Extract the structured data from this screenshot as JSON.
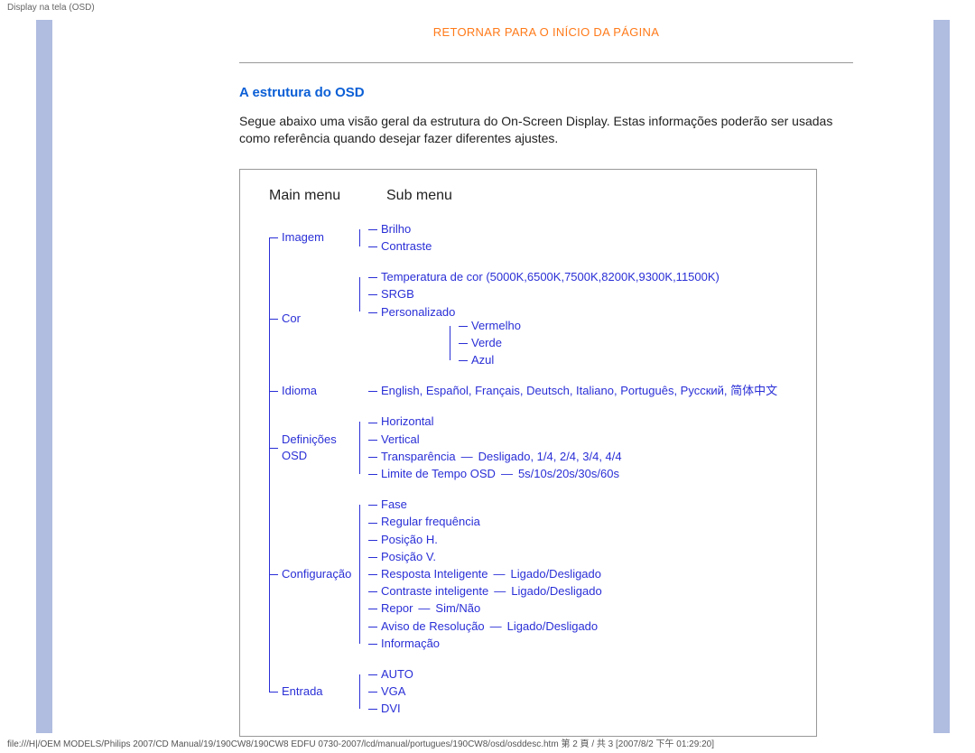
{
  "header": {
    "title": "Display na tela (OSD)"
  },
  "top_link": "Retornar para o início da página",
  "section": {
    "title": "A estrutura do OSD",
    "intro": "Segue abaixo uma visão geral da estrutura do On-Screen Display. Estas informações poderão ser usadas como referência quando desejar fazer diferentes ajustes."
  },
  "columns": {
    "main": "Main menu",
    "sub": "Sub menu"
  },
  "tree": [
    {
      "label": "Imagem",
      "subs": [
        {
          "label": "Brilho"
        },
        {
          "label": "Contraste"
        }
      ]
    },
    {
      "label": "Cor",
      "subs": [
        {
          "label": "Temperatura de cor (5000K,6500K,7500K,8200K,9300K,11500K)"
        },
        {
          "label": "SRGB"
        },
        {
          "label": "Personalizado",
          "children": [
            "Vermelho",
            "Verde",
            "Azul"
          ]
        }
      ]
    },
    {
      "label": "Idioma",
      "subs": [
        {
          "label": "English, Español, Français, Deutsch, Italiano, Português, Русский, 简体中文"
        }
      ]
    },
    {
      "label": "Definições OSD",
      "subs": [
        {
          "label": "Horizontal"
        },
        {
          "label": "Vertical"
        },
        {
          "label": "Transparência",
          "options": "Desligado, 1/4, 2/4, 3/4, 4/4"
        },
        {
          "label": "Limite de Tempo OSD",
          "options": "5s/10s/20s/30s/60s"
        }
      ]
    },
    {
      "label": "Configuração",
      "subs": [
        {
          "label": "Fase"
        },
        {
          "label": "Regular frequência"
        },
        {
          "label": "Posição H."
        },
        {
          "label": "Posição V."
        },
        {
          "label": "Resposta Inteligente",
          "options": "Ligado/Desligado"
        },
        {
          "label": "Contraste inteligente",
          "options": "Ligado/Desligado"
        },
        {
          "label": "Repor",
          "options": "Sim/Não"
        },
        {
          "label": "Aviso de Resolução",
          "options": "Ligado/Desligado"
        },
        {
          "label": "Informação"
        }
      ]
    },
    {
      "label": "Entrada",
      "subs": [
        {
          "label": "AUTO"
        },
        {
          "label": "VGA"
        },
        {
          "label": "DVI"
        }
      ]
    }
  ],
  "footer": "file:///H|/OEM MODELS/Philips 2007/CD Manual/19/190CW8/190CW8 EDFU 0730-2007/lcd/manual/portugues/190CW8/osd/osddesc.htm 第 2 頁 / 共 3  [2007/8/2 下午 01:29:20]"
}
